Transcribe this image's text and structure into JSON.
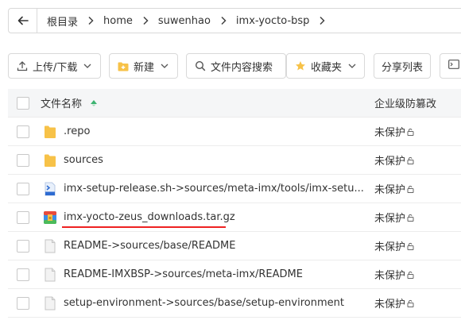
{
  "breadcrumb": {
    "items": [
      "根目录",
      "home",
      "suwenhao",
      "imx-yocto-bsp"
    ]
  },
  "toolbar": {
    "upload_label": "上传/下载",
    "new_label": "新建",
    "search_content_label": "文件内容搜索",
    "favorites_label": "收藏夹",
    "share_list_label": "分享列表"
  },
  "table": {
    "col_name": "文件名称",
    "col_perm": "企业级防篡改",
    "rows": [
      {
        "name": ".repo",
        "icon": "folder-icon",
        "perm": "未保护"
      },
      {
        "name": "sources",
        "icon": "folder-icon",
        "perm": "未保护"
      },
      {
        "name": "imx-setup-release.sh->sources/meta-imx/tools/imx-setu...",
        "icon": "shell-file-icon",
        "perm": "未保护"
      },
      {
        "name": "imx-yocto-zeus_downloads.tar.gz",
        "icon": "archive-icon",
        "perm": "未保护"
      },
      {
        "name": "README->sources/base/README",
        "icon": "document-icon",
        "perm": "未保护"
      },
      {
        "name": "README-IMXBSP->sources/meta-imx/README",
        "icon": "document-icon",
        "perm": "未保护"
      },
      {
        "name": "setup-environment->sources/base/setup-environment",
        "icon": "document-icon",
        "perm": "未保护"
      }
    ]
  },
  "colors": {
    "folder": "#f7c248",
    "highlight_underline": "#e22222",
    "accent_green": "#3cb371"
  }
}
